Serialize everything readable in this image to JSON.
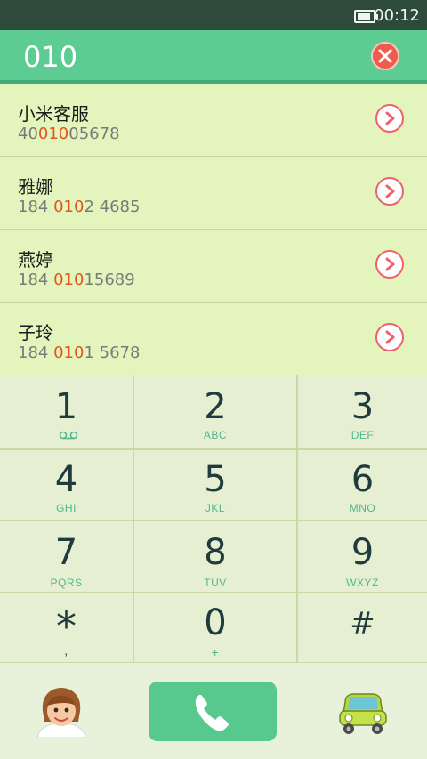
{
  "status_bar": {
    "time": "00:12",
    "battery_icon": "battery-icon"
  },
  "dialer": {
    "input": "010",
    "clear_icon": "close-icon"
  },
  "contacts": [
    {
      "name": "小米客服",
      "number_pre": "40",
      "number_hl": "010",
      "number_post": "05678"
    },
    {
      "name": "雅娜",
      "number_pre": "184 ",
      "number_hl": "010",
      "number_post": "2 4685"
    },
    {
      "name": "燕婷",
      "number_pre": "184 ",
      "number_hl": "010",
      "number_post": "15689"
    },
    {
      "name": "子玲",
      "number_pre": "184 ",
      "number_hl": "010",
      "number_post": "1 5678"
    }
  ],
  "keypad": [
    {
      "digit": "1",
      "letters": ""
    },
    {
      "digit": "2",
      "letters": "ABC"
    },
    {
      "digit": "3",
      "letters": "DEF"
    },
    {
      "digit": "4",
      "letters": "GHI"
    },
    {
      "digit": "5",
      "letters": "JKL"
    },
    {
      "digit": "6",
      "letters": "MNO"
    },
    {
      "digit": "7",
      "letters": "PQRS"
    },
    {
      "digit": "8",
      "letters": "TUV"
    },
    {
      "digit": "9",
      "letters": "WXYZ"
    },
    {
      "digit": "*",
      "letters": ","
    },
    {
      "digit": "0",
      "letters": "+"
    },
    {
      "digit": "#",
      "letters": ""
    }
  ],
  "bottom_bar": {
    "contacts_icon": "avatar-icon",
    "call_icon": "phone-icon",
    "car_icon": "car-icon"
  },
  "colors": {
    "accent": "#58c98d",
    "highlight": "#e2551d",
    "status_bg": "#2e4a3a"
  }
}
